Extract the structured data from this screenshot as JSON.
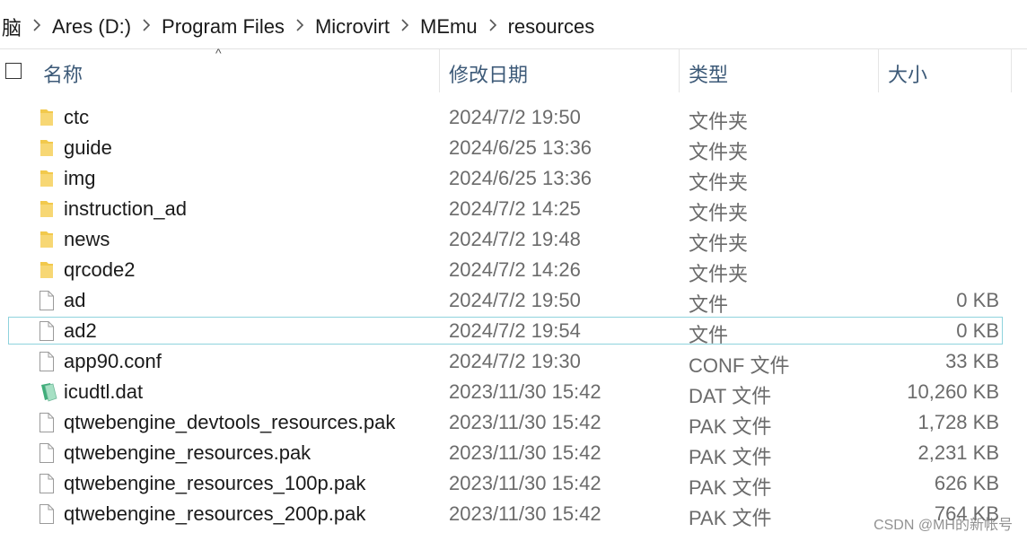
{
  "breadcrumb": {
    "items": [
      "脑",
      "Ares (D:)",
      "Program Files",
      "Microvirt",
      "MEmu",
      "resources"
    ]
  },
  "columns": {
    "name": "名称",
    "date": "修改日期",
    "type": "类型",
    "size": "大小"
  },
  "files": [
    {
      "name": "ctc",
      "date": "2024/7/2 19:50",
      "type": "文件夹",
      "size": "",
      "icon": "folder-icon"
    },
    {
      "name": "guide",
      "date": "2024/6/25 13:36",
      "type": "文件夹",
      "size": "",
      "icon": "folder-icon"
    },
    {
      "name": "img",
      "date": "2024/6/25 13:36",
      "type": "文件夹",
      "size": "",
      "icon": "folder-icon"
    },
    {
      "name": "instruction_ad",
      "date": "2024/7/2 14:25",
      "type": "文件夹",
      "size": "",
      "icon": "folder-icon"
    },
    {
      "name": "news",
      "date": "2024/7/2 19:48",
      "type": "文件夹",
      "size": "",
      "icon": "folder-icon"
    },
    {
      "name": "qrcode2",
      "date": "2024/7/2 14:26",
      "type": "文件夹",
      "size": "",
      "icon": "folder-icon"
    },
    {
      "name": "ad",
      "date": "2024/7/2 19:50",
      "type": "文件",
      "size": "0 KB",
      "icon": "file-icon"
    },
    {
      "name": "ad2",
      "date": "2024/7/2 19:54",
      "type": "文件",
      "size": "0 KB",
      "icon": "file-icon",
      "selected": true
    },
    {
      "name": "app90.conf",
      "date": "2024/7/2 19:30",
      "type": "CONF 文件",
      "size": "33 KB",
      "icon": "file-icon"
    },
    {
      "name": "icudtl.dat",
      "date": "2023/11/30 15:42",
      "type": "DAT 文件",
      "size": "10,260 KB",
      "icon": "data-file-icon"
    },
    {
      "name": "qtwebengine_devtools_resources.pak",
      "date": "2023/11/30 15:42",
      "type": "PAK 文件",
      "size": "1,728 KB",
      "icon": "file-icon"
    },
    {
      "name": "qtwebengine_resources.pak",
      "date": "2023/11/30 15:42",
      "type": "PAK 文件",
      "size": "2,231 KB",
      "icon": "file-icon"
    },
    {
      "name": "qtwebengine_resources_100p.pak",
      "date": "2023/11/30 15:42",
      "type": "PAK 文件",
      "size": "626 KB",
      "icon": "file-icon"
    },
    {
      "name": "qtwebengine_resources_200p.pak",
      "date": "2023/11/30 15:42",
      "type": "PAK 文件",
      "size": "764 KB",
      "icon": "file-icon"
    }
  ],
  "watermark": "CSDN @MH的新帐号",
  "colors": {
    "folder": "#f2c94c",
    "selection_border": "#8fd3dd",
    "header_text": "#3d5a78"
  }
}
